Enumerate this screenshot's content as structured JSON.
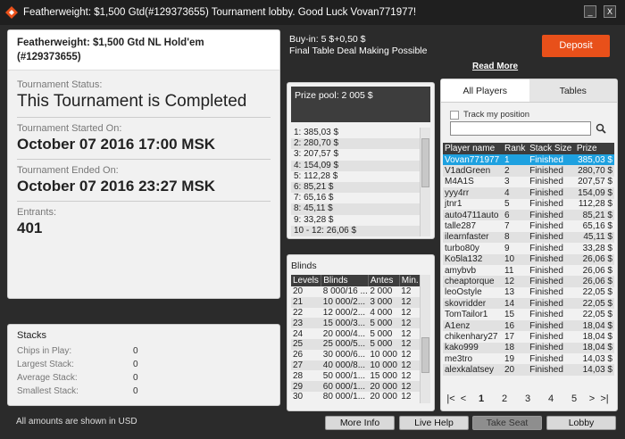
{
  "window": {
    "title": "Featherweight: $1,500 Gtd(#129373655) Tournament lobby. Good Luck Vovan771977!",
    "minimize": "_",
    "close": "X"
  },
  "info": {
    "name": "Featherweight: $1,500 Gtd NL Hold'em (#129373655)",
    "status_label": "Tournament Status:",
    "status_value": "This Tournament is Completed",
    "started_label": "Tournament Started On:",
    "started_value": "October 07 2016  17:00 MSK",
    "ended_label": "Tournament Ended On:",
    "ended_value": "October 07 2016  23:27 MSK",
    "entrants_label": "Entrants:",
    "entrants_value": "401"
  },
  "stacks": {
    "title": "Stacks",
    "rows": [
      {
        "label": "Chips in Play:",
        "value": "0"
      },
      {
        "label": "Largest Stack:",
        "value": "0"
      },
      {
        "label": "Average Stack:",
        "value": "0"
      },
      {
        "label": "Smallest Stack:",
        "value": "0"
      }
    ]
  },
  "footnote": "All amounts are shown in USD",
  "header": {
    "buyin": "Buy-in: 5 $+0,50 $",
    "deal": "Final Table Deal Making Possible",
    "read_more": "Read More",
    "deposit": "Deposit"
  },
  "prize": {
    "title": "Prize pool: 2 005 $",
    "items": [
      "1: 385,03 $",
      "2: 280,70 $",
      "3: 207,57 $",
      "4: 154,09 $",
      "5: 112,28 $",
      "6: 85,21 $",
      "7: 65,16 $",
      "8: 45,11 $",
      "9: 33,28 $",
      "10 - 12: 26,06 $"
    ]
  },
  "blinds": {
    "title": "Blinds",
    "headers": [
      "Levels",
      "Blinds",
      "Antes",
      "Min."
    ],
    "rows": [
      [
        "20",
        "8 000/16 ...",
        "2 000",
        "12"
      ],
      [
        "21",
        "10 000/2...",
        "3 000",
        "12"
      ],
      [
        "22",
        "12 000/2...",
        "4 000",
        "12"
      ],
      [
        "23",
        "15 000/3...",
        "5 000",
        "12"
      ],
      [
        "24",
        "20 000/4...",
        "5 000",
        "12"
      ],
      [
        "25",
        "25 000/5...",
        "5 000",
        "12"
      ],
      [
        "26",
        "30 000/6...",
        "10 000",
        "12"
      ],
      [
        "27",
        "40 000/8...",
        "10 000",
        "12"
      ],
      [
        "28",
        "50 000/1...",
        "15 000",
        "12"
      ],
      [
        "29",
        "60 000/1...",
        "20 000",
        "12"
      ],
      [
        "30",
        "80 000/1...",
        "20 000",
        "12"
      ]
    ]
  },
  "players": {
    "tabs": [
      "All Players",
      "Tables"
    ],
    "track_label": "Track my position",
    "search_placeholder": "",
    "headers": [
      "Player name",
      "Rank",
      "Stack Size",
      "Prize"
    ],
    "rows": [
      [
        "Vovan771977",
        "1",
        "Finished",
        "385,03 $"
      ],
      [
        "V1adGreen",
        "2",
        "Finished",
        "280,70 $"
      ],
      [
        "M4A1S",
        "3",
        "Finished",
        "207,57 $"
      ],
      [
        "yyy4rr",
        "4",
        "Finished",
        "154,09 $"
      ],
      [
        "jtnr1",
        "5",
        "Finished",
        "112,28 $"
      ],
      [
        "auto4711auto",
        "6",
        "Finished",
        "85,21 $"
      ],
      [
        "talle287",
        "7",
        "Finished",
        "65,16 $"
      ],
      [
        "ilearnfaster",
        "8",
        "Finished",
        "45,11 $"
      ],
      [
        "turbo80y",
        "9",
        "Finished",
        "33,28 $"
      ],
      [
        "Ko5la132",
        "10",
        "Finished",
        "26,06 $"
      ],
      [
        "amybvb",
        "11",
        "Finished",
        "26,06 $"
      ],
      [
        "cheaptorque",
        "12",
        "Finished",
        "26,06 $"
      ],
      [
        "leoOstyle",
        "13",
        "Finished",
        "22,05 $"
      ],
      [
        "skovridder",
        "14",
        "Finished",
        "22,05 $"
      ],
      [
        "TomTailor1",
        "15",
        "Finished",
        "22,05 $"
      ],
      [
        "A1enz",
        "16",
        "Finished",
        "18,04 $"
      ],
      [
        "chikenhary27",
        "17",
        "Finished",
        "18,04 $"
      ],
      [
        "kako999",
        "18",
        "Finished",
        "18,04 $"
      ],
      [
        "me3tro",
        "19",
        "Finished",
        "14,03 $"
      ],
      [
        "alexkalatsey",
        "20",
        "Finished",
        "14,03 $"
      ]
    ],
    "pager": {
      "first": "|<",
      "prev": "<",
      "pages": [
        "1",
        "2",
        "3",
        "4",
        "5"
      ],
      "next": ">",
      "last": ">|"
    }
  },
  "buttons": {
    "more_info": "More Info",
    "live_help": "Live Help",
    "take_seat": "Take Seat",
    "lobby": "Lobby"
  },
  "colors": {
    "accent": "#e8501a",
    "selection": "#1ea1e0"
  }
}
